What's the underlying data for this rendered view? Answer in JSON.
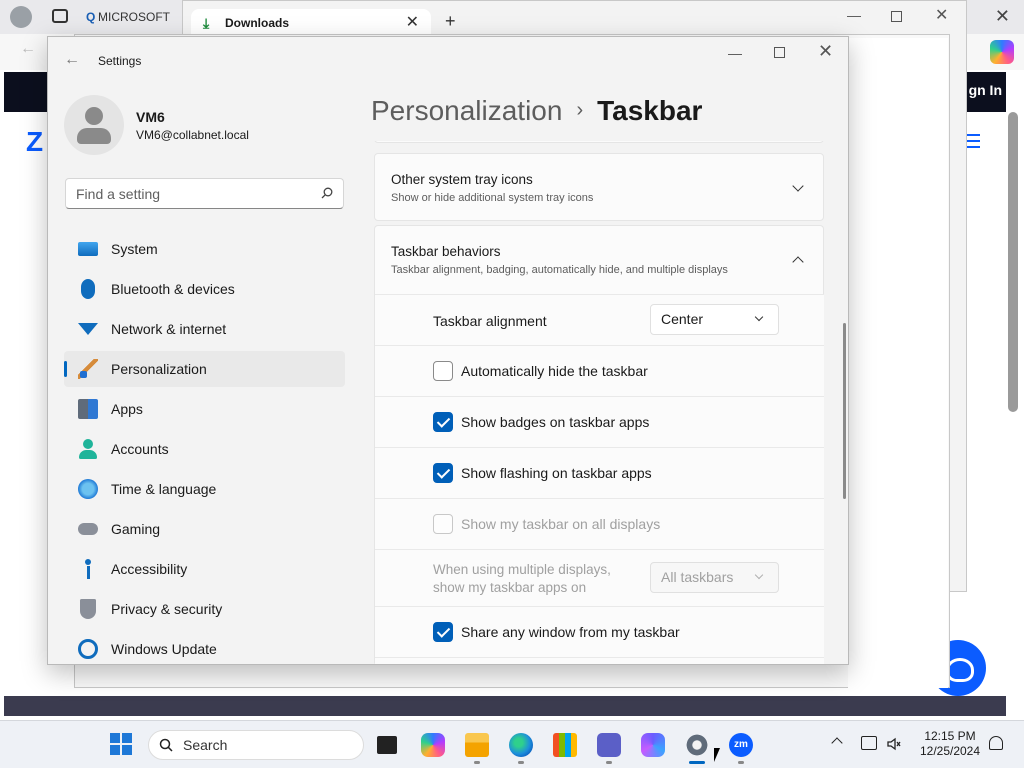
{
  "background": {
    "browser_tab_title": "MICROSOFT",
    "downloads_tab_title": "Downloads",
    "sign_in_label": "gn In"
  },
  "settings": {
    "app_title": "Settings",
    "user": {
      "name": "VM6",
      "email": "VM6@collabnet.local"
    },
    "search": {
      "placeholder": "Find a setting"
    },
    "nav": [
      {
        "label": "System",
        "icon": "system-icon"
      },
      {
        "label": "Bluetooth & devices",
        "icon": "bluetooth-icon"
      },
      {
        "label": "Network & internet",
        "icon": "wifi-icon"
      },
      {
        "label": "Personalization",
        "icon": "brush-icon",
        "active": true
      },
      {
        "label": "Apps",
        "icon": "apps-icon"
      },
      {
        "label": "Accounts",
        "icon": "person-icon"
      },
      {
        "label": "Time & language",
        "icon": "globe-clock-icon"
      },
      {
        "label": "Gaming",
        "icon": "gamepad-icon"
      },
      {
        "label": "Accessibility",
        "icon": "accessibility-icon"
      },
      {
        "label": "Privacy & security",
        "icon": "shield-icon"
      },
      {
        "label": "Windows Update",
        "icon": "update-icon"
      }
    ],
    "breadcrumb": {
      "parent": "Personalization",
      "separator": "›",
      "current": "Taskbar"
    },
    "sections": {
      "tray_icons": {
        "title": "Other system tray icons",
        "description": "Show or hide additional system tray icons"
      },
      "behaviors": {
        "title": "Taskbar behaviors",
        "description": "Taskbar alignment, badging, automatically hide, and multiple displays",
        "alignment_label": "Taskbar alignment",
        "alignment_value": "Center",
        "auto_hide_label": "Automatically hide the taskbar",
        "auto_hide_checked": false,
        "badges_label": "Show badges on taskbar apps",
        "badges_checked": true,
        "flashing_label": "Show flashing on taskbar apps",
        "flashing_checked": true,
        "all_displays_label": "Show my taskbar on all displays",
        "all_displays_checked": false,
        "multi_display_label_line1": "When using multiple displays,",
        "multi_display_label_line2": "show my taskbar apps on",
        "multi_display_value": "All taskbars",
        "share_window_label": "Share any window from my taskbar",
        "share_window_checked": true
      }
    }
  },
  "taskbar": {
    "search_placeholder": "Search",
    "zoom_label": "zm",
    "clock_time": "12:15 PM",
    "clock_date": "12/25/2024"
  },
  "colors": {
    "accent": "#005fb8",
    "window_bg": "#f3f3f3",
    "card_bg": "#fbfbfb"
  }
}
